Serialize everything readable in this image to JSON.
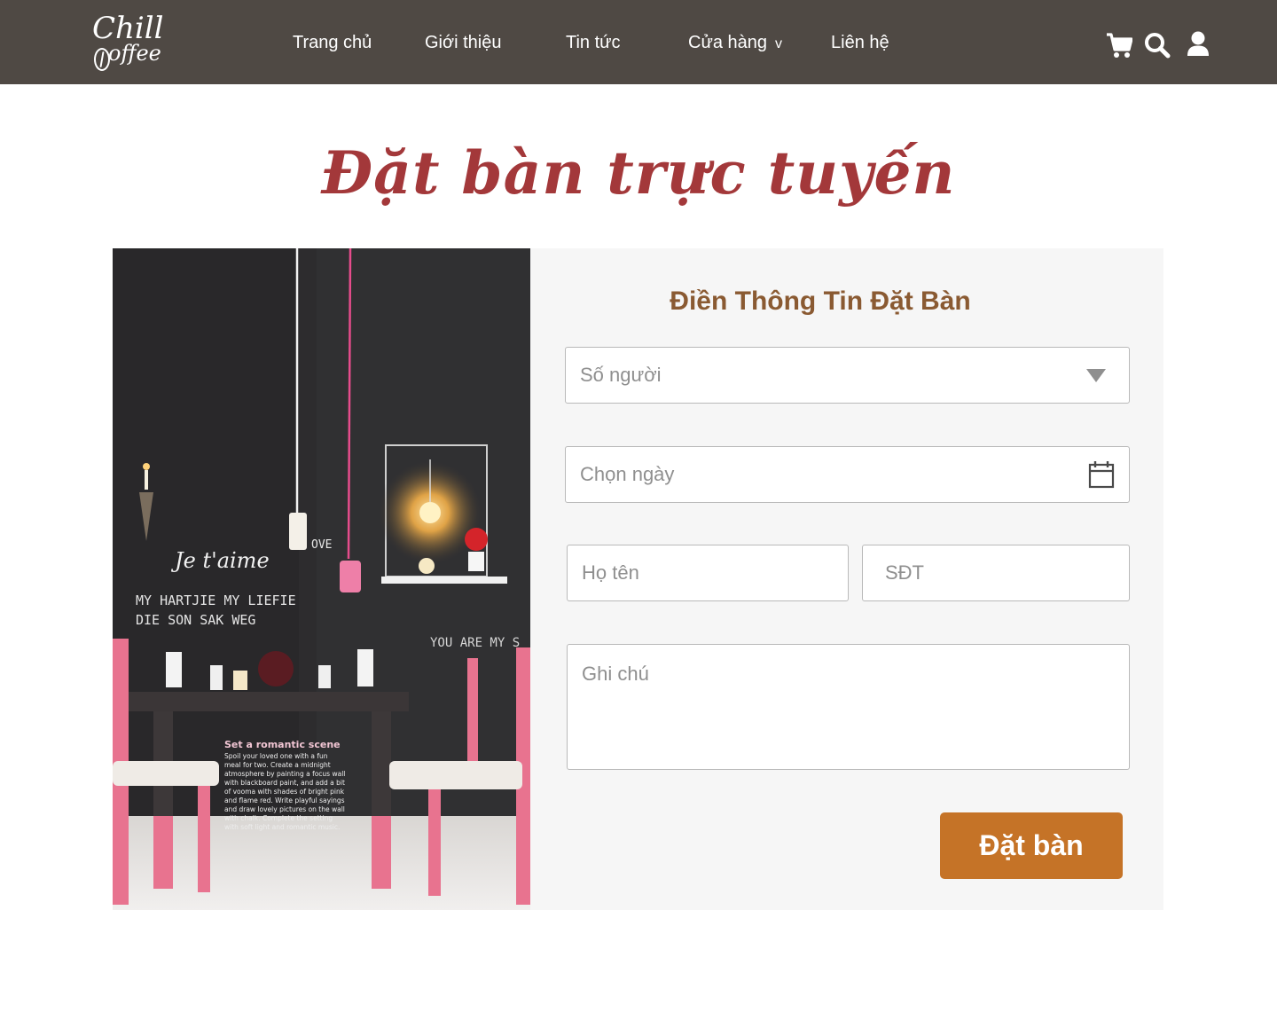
{
  "brand": {
    "logo_line1": "Chill",
    "logo_line2": "offee"
  },
  "nav": {
    "items": [
      "Trang chủ",
      "Giới thiệu",
      "Tin tức",
      "Cửa hàng",
      "Liên hệ"
    ],
    "dropdown_caret": "v",
    "icons": [
      "cart-icon",
      "search-icon",
      "user-icon"
    ]
  },
  "page": {
    "title": "Đặt bàn trực tuyến"
  },
  "hero": {
    "scene_texts": {
      "love": "OVE",
      "jetaime": "Je t'aime",
      "line1": "MY HARTJIE MY LIEFIE",
      "line2": "DIE SON SAK WEG",
      "line3": "YOU ARE MY S",
      "caption_title": "Set a romantic scene",
      "caption_body": [
        "Spoil your loved one with a fun",
        "meal for two. Create a midnight",
        "atmosphere by painting a focus wall",
        "with blackboard paint, and add a bit",
        "of vooma with shades of bright pink",
        "and flame red. Write playful sayings",
        "and draw lovely pictures on the wall",
        "with chalk. Complete the setting",
        "with soft light and romantic music."
      ]
    }
  },
  "form": {
    "title": "Điền Thông Tin Đặt Bàn",
    "people_placeholder": "Số người",
    "date_placeholder": "Chọn ngày",
    "name_placeholder": "Họ tên",
    "phone_placeholder": "SĐT",
    "note_placeholder": "Ghi chú",
    "submit_label": "Đặt bàn"
  },
  "colors": {
    "navbar": "#4f4944",
    "title": "#a3383a",
    "form_title": "#8a5a32",
    "button": "#c57327",
    "panel": "#f6f6f6"
  }
}
